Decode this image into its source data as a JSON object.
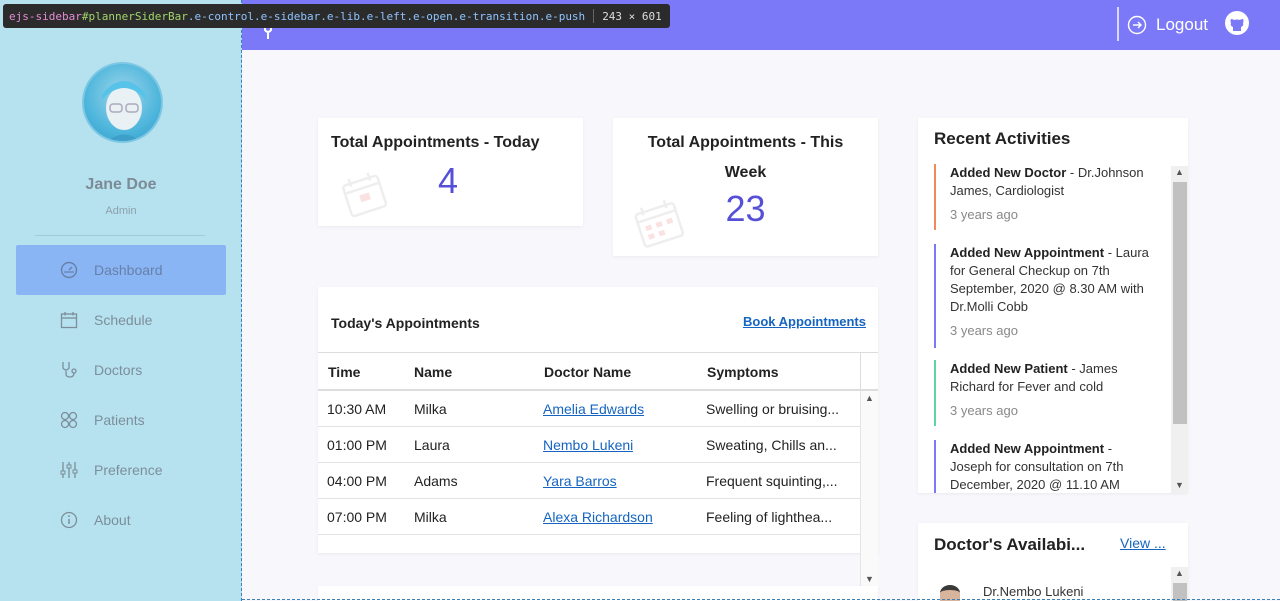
{
  "header": {
    "title": "APPOINTMENT PLANNER",
    "logout_label": "Logout"
  },
  "devtools_tooltip": {
    "tag": "ejs-sidebar",
    "id": "#plannerSiderBar",
    "classes": ".e-control.e-sidebar.e-lib.e-left.e-open.e-transition.e-push",
    "size": "243 × 601"
  },
  "user": {
    "name": "Jane Doe",
    "role": "Admin"
  },
  "nav": {
    "items": [
      {
        "label": "Dashboard",
        "icon": "dashboard-icon",
        "active": true
      },
      {
        "label": "Schedule",
        "icon": "calendar-icon"
      },
      {
        "label": "Doctors",
        "icon": "stethoscope-icon"
      },
      {
        "label": "Patients",
        "icon": "patients-icon"
      },
      {
        "label": "Preference",
        "icon": "sliders-icon"
      },
      {
        "label": "About",
        "icon": "info-icon"
      }
    ]
  },
  "stats": {
    "today": {
      "title": "Total Appointments - Today",
      "value": "4"
    },
    "week": {
      "title_line1": "Total Appointments - This",
      "title_line2": "Week",
      "value": "23"
    }
  },
  "appointments": {
    "title": "Today's Appointments",
    "book_label": "Book Appointments",
    "columns": [
      "Time",
      "Name",
      "Doctor Name",
      "Symptoms"
    ],
    "rows": [
      {
        "time": "10:30 AM",
        "name": "Milka",
        "doctor": "Amelia Edwards",
        "symptoms": "Swelling or bruising..."
      },
      {
        "time": "01:00 PM",
        "name": "Laura",
        "doctor": "Nembo Lukeni",
        "symptoms": "Sweating, Chills an..."
      },
      {
        "time": "04:00 PM",
        "name": "Adams",
        "doctor": "Yara Barros",
        "symptoms": "Frequent squinting,..."
      },
      {
        "time": "07:00 PM",
        "name": "Milka",
        "doctor": "Alexa Richardson",
        "symptoms": "Feeling of lighthea..."
      }
    ]
  },
  "recent": {
    "title": "Recent Activities",
    "items": [
      {
        "action": "Added New Doctor",
        "detail": " - Dr.Johnson James, Cardiologist",
        "time": "3 years ago",
        "color": "#f08a5d"
      },
      {
        "action": "Added New Appointment",
        "detail": " - Laura for General Checkup on 7th September, 2020 @ 8.30 AM with Dr.Molli Cobb",
        "time": "3 years ago",
        "color": "#7b79f7"
      },
      {
        "action": "Added New Patient",
        "detail": " - James Richard for Fever and cold",
        "time": "3 years ago",
        "color": "#5fd3a4"
      },
      {
        "action": "Added New Appointment",
        "detail": " - Joseph for consultation on 7th December, 2020 @ 11.10 AM",
        "time": "",
        "color": "#7b79f7"
      }
    ]
  },
  "doctors": {
    "title": "Doctor's Availabi...",
    "view_label": "View ...",
    "first_doctor": "Dr.Nembo Lukeni"
  },
  "colors": {
    "header": "#7b79f7",
    "sidebar": "#b6e2f0",
    "accent": "#5650d6",
    "link": "#1565c0"
  }
}
